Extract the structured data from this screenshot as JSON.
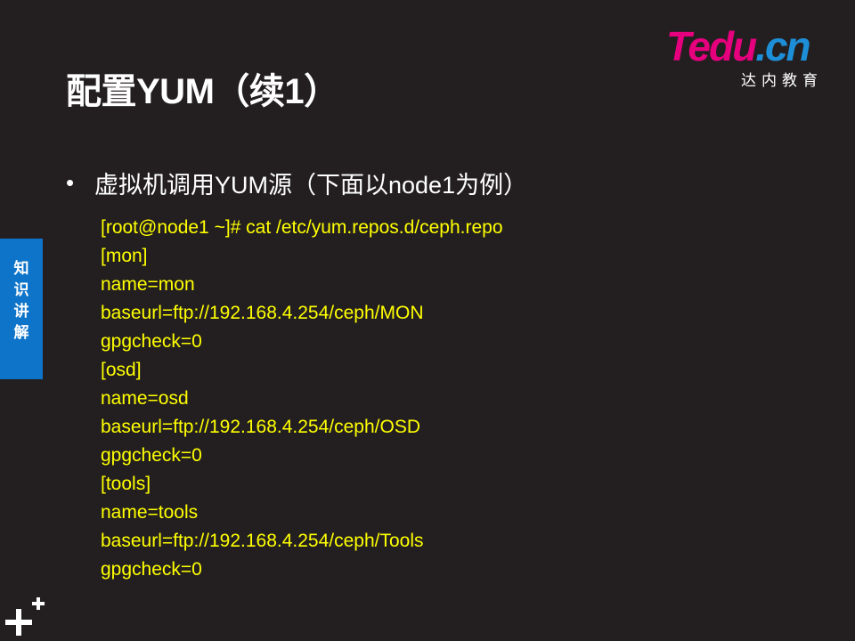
{
  "slide": {
    "title": "配置YUM（续1）",
    "logo": {
      "wordmark_t": "T",
      "wordmark_edu": "edu",
      "wordmark_cn": ".cn",
      "subtitle": "达内教育"
    },
    "bullet": {
      "text": "虚拟机调用YUM源（下面以node1为例）"
    },
    "code_lines": [
      "[root@node1 ~]# cat /etc/yum.repos.d/ceph.repo",
      "[mon]",
      "name=mon",
      "baseurl=ftp://192.168.4.254/ceph/MON",
      "gpgcheck=0",
      "[osd]",
      "name=osd",
      "baseurl=ftp://192.168.4.254/ceph/OSD",
      "gpgcheck=0",
      "[tools]",
      "name=tools",
      "baseurl=ftp://192.168.4.254/ceph/Tools",
      "gpgcheck=0"
    ],
    "side_tab": {
      "chars": [
        "知",
        "识",
        "讲",
        "解"
      ]
    }
  },
  "colors": {
    "background": "#231f20",
    "title": "#ffffff",
    "code": "#ffff00",
    "side_tab": "#0e74c9",
    "logo_pink": "#e6007e",
    "logo_blue": "#1d8fd8"
  },
  "icons": {
    "bullet": "bullet-dot-icon",
    "corner": "plus-plus-icon"
  }
}
